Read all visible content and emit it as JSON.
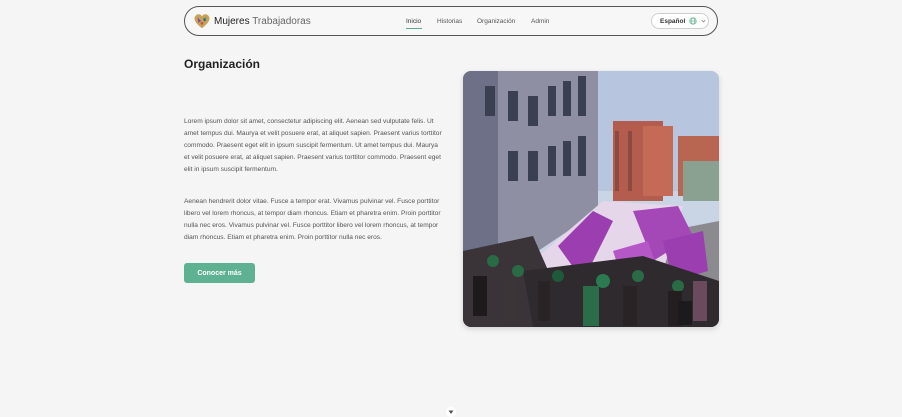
{
  "nav": {
    "brand_primary": "Mujeres",
    "brand_secondary": "Trabajadoras",
    "links": [
      "Inicio",
      "Historias",
      "Organización",
      "Admin"
    ],
    "active_link": "Inicio",
    "language": "Español",
    "language_icon": "globe-icon",
    "dropdown_icon": "chevron-down-icon",
    "logo_icon": "heart-logo-icon"
  },
  "main": {
    "title": "Organización",
    "paragraphs": [
      "Lorem ipsum dolor sit amet, consectetur adipiscing elit. Aenean sed vulputate felis. Ut amet tempus dui. Maurya et velit posuere erat, at aliquet sapien. Praesent varius torttitor commodo. Praesent eget elit in ipsum suscipit fermentum. Ut amet tempus dui. Maurya et velit posuere erat, at aliquet sapien. Praesent varius torttitor commodo. Praesent eget elit in ipsum suscipit fermentum.",
      "Aenean hendrerit dolor vitae. Fusce a tempor erat. Vivamus pulvinar vel. Fusce porttitor libero vel lorem rhoncus, at tempor diam rhoncus. Etiam et pharetra enim. Proin porttitor nulla nec eros. Vivamus pulvinar vel. Fusce porttitor libero vel lorem rhoncus, at tempor diam rhoncus. Etiam et pharetra enim. Proin porttitor nulla nec eros."
    ],
    "cta_label": "Conocer más",
    "photo_icon": "march-photo"
  },
  "scroll_icon": "scroll-down-icon",
  "colors": {
    "accent": "#5fb291",
    "background": "#f5f5f5",
    "banner_purple": "#9b3fb0"
  }
}
